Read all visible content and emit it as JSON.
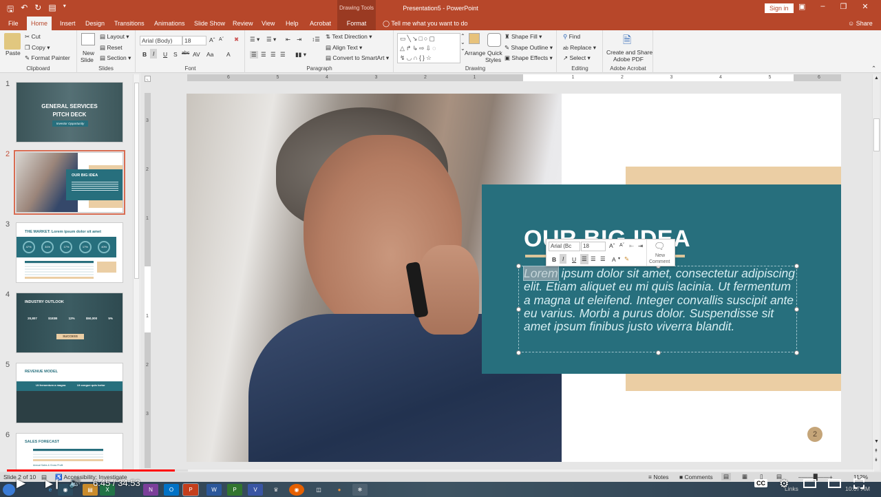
{
  "titlebar": {
    "context_title": "Drawing Tools",
    "doc_title": "Presentation5  -  PowerPoint",
    "signin": "Sign in",
    "qat": [
      "save-icon",
      "undo-icon",
      "redo-icon",
      "present-icon",
      "customize-icon"
    ]
  },
  "tabs": [
    {
      "label": "File"
    },
    {
      "label": "Home",
      "active": true
    },
    {
      "label": "Insert"
    },
    {
      "label": "Design"
    },
    {
      "label": "Transitions"
    },
    {
      "label": "Animations"
    },
    {
      "label": "Slide Show"
    },
    {
      "label": "Review"
    },
    {
      "label": "View"
    },
    {
      "label": "Help"
    },
    {
      "label": "Acrobat"
    },
    {
      "label": "Format",
      "contextual": true
    }
  ],
  "tellme": "Tell me what you want to do",
  "share": "Share",
  "ribbon": {
    "clipboard": {
      "label": "Clipboard",
      "paste": "Paste",
      "cut": "Cut",
      "copy": "Copy",
      "format_painter": "Format Painter"
    },
    "slides": {
      "label": "Slides",
      "new_slide": "New",
      "new_slide2": "Slide",
      "layout": "Layout",
      "reset": "Reset",
      "section": "Section"
    },
    "font": {
      "label": "Font",
      "font_name": "Arial (Body)",
      "font_size": "18",
      "bold": "B",
      "italic": "I",
      "underline": "U",
      "shadow": "S",
      "strike": "abc",
      "spacing": "AV",
      "case": "Aa",
      "color": "A"
    },
    "paragraph": {
      "label": "Paragraph",
      "text_direction": "Text Direction",
      "align_text": "Align Text",
      "smartart": "Convert to SmartArt"
    },
    "drawing": {
      "label": "Drawing",
      "arrange": "Arrange",
      "quick_styles": "Quick",
      "quick_styles2": "Styles",
      "shape_fill": "Shape Fill",
      "shape_outline": "Shape Outline",
      "shape_effects": "Shape Effects"
    },
    "editing": {
      "label": "Editing",
      "find": "Find",
      "replace": "Replace",
      "select": "Select"
    },
    "acrobat": {
      "label": "Adobe Acrobat",
      "create": "Create and Share",
      "create2": "Adobe PDF"
    }
  },
  "thumbnails": [
    {
      "num": "1",
      "title": "GENERAL SERVICES",
      "title2": "PITCH DECK",
      "sub": "Investor Opportunity"
    },
    {
      "num": "2",
      "title": "OUR BIG IDEA",
      "selected": true
    },
    {
      "num": "3",
      "title": "THE MARKET: Lorem ipsum dolor sit amet",
      "stats": [
        "47%",
        "31%",
        "17%",
        "17%",
        "40%"
      ]
    },
    {
      "num": "4",
      "title": "INDUSTRY OUTLOOK",
      "stats": [
        "20,807",
        "$183B",
        "12%",
        "$50,000",
        "5%"
      ],
      "badge": "SUCCESS"
    },
    {
      "num": "5",
      "title": "REVENUE MODEL",
      "col1": "Ut fermentum a magna",
      "col2": "Ut congue quis tortor"
    },
    {
      "num": "6",
      "title": "SALES FORECAST",
      "sub": "Annual Sales & Gross Profit"
    }
  ],
  "ruler": {
    "h_labels": [
      "6",
      "5",
      "4",
      "3",
      "2",
      "1",
      "",
      "1",
      "2",
      "3",
      "4",
      "5",
      "6"
    ],
    "v_labels": [
      "3",
      "2",
      "1",
      "",
      "1",
      "2",
      "3"
    ]
  },
  "slide": {
    "title": "OUR BIG IDEA",
    "selected_word": "Lorem",
    "body": " ipsum dolor sit amet, consectetur adipiscing elit. Etiam aliquet eu mi quis lacinia.  Ut fermentum a magna ut eleifend. Integer convallis suscipit ante eu varius. Morbi a purus dolor. Suspendisse sit amet ipsum finibus justo viverra blandit.",
    "page_number": "2",
    "colors": {
      "teal": "#276f7d",
      "tan": "#ebcea4",
      "accent": "#b7472a"
    }
  },
  "mini_toolbar": {
    "font": "Arial (Bc",
    "size": "18",
    "bold": "B",
    "italic": "I",
    "underline": "U",
    "color": "A",
    "new_comment": "New",
    "new_comment2": "Comment"
  },
  "status": {
    "slide": "Slide 2 of 10",
    "accessibility": "Accessibility: Investigate",
    "notes": "Notes",
    "comments": "Comments",
    "zoom": "112%"
  },
  "video": {
    "time": "6:45 / 34:53",
    "progress_pct": 19.4,
    "cc": "CC"
  },
  "taskbar": {
    "clock": "10:07 AM",
    "links": "Links"
  }
}
